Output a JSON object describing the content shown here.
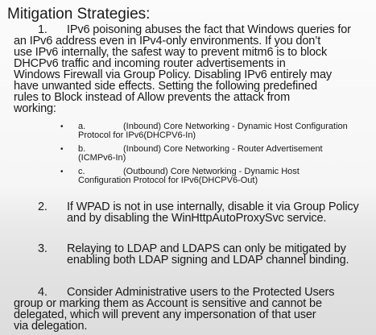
{
  "heading": "Mitigation Strategies:",
  "items": [
    {
      "num": "1.",
      "lines": [
        "IPv6 poisoning abuses the fact that Windows queries for",
        "an IPv6 address even in IPv4-only environments. If you don’t",
        "use IPv6 internally, the safest way to prevent mitm6 is to block",
        "DHCPv6 traffic and incoming router advertisements in",
        "Windows Firewall via Group Policy. Disabling IPv6 entirely may",
        "have unwanted side effects. Setting the following predefined",
        "rules to Block instead of Allow prevents the attack from",
        "working:"
      ],
      "subitems": [
        {
          "label": "a.",
          "lines": [
            "(Inbound) Core Networking - Dynamic Host Configuration",
            "Protocol for IPv6(DHCPV6-In)"
          ]
        },
        {
          "label": "b.",
          "lines": [
            "(Inbound) Core Networking - Router Advertisement",
            "(ICMPv6-In)"
          ]
        },
        {
          "label": "c.",
          "lines": [
            "(Outbound) Core Networking - Dynamic Host",
            "Configuration Protocol for IPv6(DHCPV6-Out)"
          ]
        }
      ]
    },
    {
      "num": "2.",
      "lines": [
        "If WPAD is not in use internally, disable it via Group Policy",
        "and by disabling the WinHttpAutoProxySvc service."
      ]
    },
    {
      "num": "3.",
      "lines": [
        "Relaying to LDAP and LDAPS can only be mitigated by",
        "enabling both LDAP signing and LDAP channel binding."
      ]
    },
    {
      "num": "4.",
      "lines": [
        "Consider Administrative users to the Protected Users",
        "group or marking them as Account is sensitive and cannot be",
        "delegated, which will prevent any impersonation of that user",
        "via delegation."
      ]
    }
  ]
}
